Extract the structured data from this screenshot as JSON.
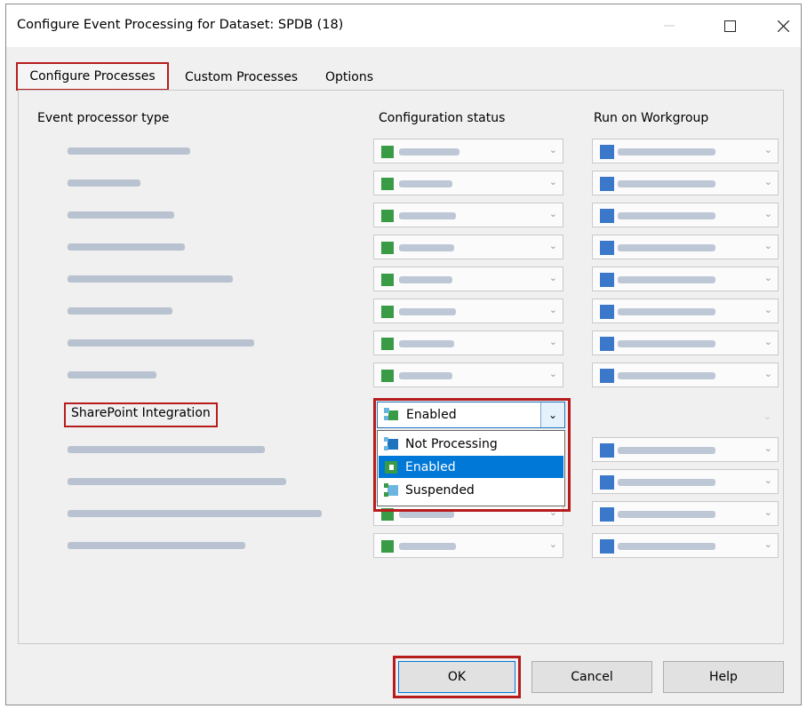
{
  "window": {
    "title": "Configure Event Processing for Dataset: SPDB (18)",
    "controls": [
      "minimize-icon",
      "maximize-icon",
      "close-icon"
    ]
  },
  "tabs": [
    {
      "label": "Configure Processes",
      "active": true
    },
    {
      "label": "Custom Processes",
      "active": false
    },
    {
      "label": "Options",
      "active": false
    }
  ],
  "columns": {
    "type": "Event processor type",
    "status": "Configuration status",
    "workgroup": "Run on Workgroup"
  },
  "highlighted_row": {
    "label": "SharePoint Integration",
    "status_value": "Enabled"
  },
  "dropdown": {
    "options": [
      "Not Processing",
      "Enabled",
      "Suspended"
    ],
    "selected": "Enabled"
  },
  "buttons": {
    "ok": "OK",
    "cancel": "Cancel",
    "help": "Help"
  },
  "colors": {
    "highlight_outline": "#b71c1c",
    "selection": "#0078d7",
    "status_icon": "#3a9b47",
    "workgroup_icon": "#3b78c9"
  }
}
